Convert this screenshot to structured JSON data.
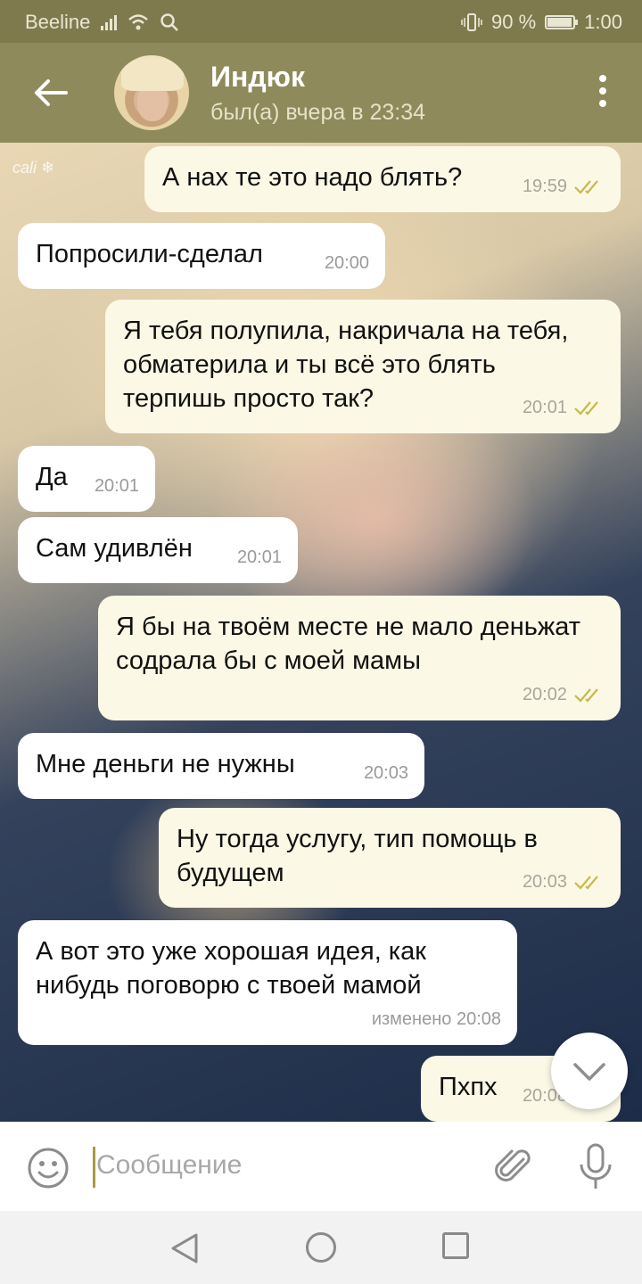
{
  "status_bar": {
    "carrier": "Beeline",
    "battery_text": "90 %",
    "time": "1:00",
    "battery_level": 0.9
  },
  "header": {
    "title": "Индюк",
    "subtitle": "был(а) вчера в 23:34",
    "back_icon": "arrow-left-icon",
    "menu_icon": "more-vertical-icon"
  },
  "chat": {
    "watermark": "cali ❄",
    "messages": [
      {
        "dir": "out",
        "text": "А нах те это надо блять?",
        "time": "19:59",
        "read": true
      },
      {
        "dir": "in",
        "text": "Попросили-сделал",
        "time": "20:00"
      },
      {
        "dir": "out",
        "text": "Я тебя полупила, накричала на тебя, обматерила и ты всё это блять терпишь просто так?",
        "time": "20:01",
        "read": true
      },
      {
        "dir": "in",
        "text": "Да",
        "time": "20:01"
      },
      {
        "dir": "in",
        "text": "Сам удивлён",
        "time": "20:01"
      },
      {
        "dir": "out",
        "text": "Я бы на твоём месте не мало деньжат содрала бы с моей мамы",
        "time": "20:02",
        "read": true
      },
      {
        "dir": "in",
        "text": "Мне деньги не нужны",
        "time": "20:03"
      },
      {
        "dir": "out",
        "text": "Ну тогда услугу, тип помощь в будущем",
        "time": "20:03",
        "read": true
      },
      {
        "dir": "in",
        "text": "А вот это уже хорошая идея, как нибудь поговорю с твоей мамой",
        "time": "изменено 20:08"
      },
      {
        "dir": "out",
        "text": "Пхпх",
        "time": "20:08",
        "read": true
      }
    ]
  },
  "input": {
    "placeholder": "Сообщение"
  },
  "colors": {
    "header": "#8e8a5c",
    "status_bar": "#7f7a4e",
    "outgoing_bubble": "#fbf8e6",
    "incoming_bubble": "#ffffff",
    "check": "#c9b94a"
  }
}
